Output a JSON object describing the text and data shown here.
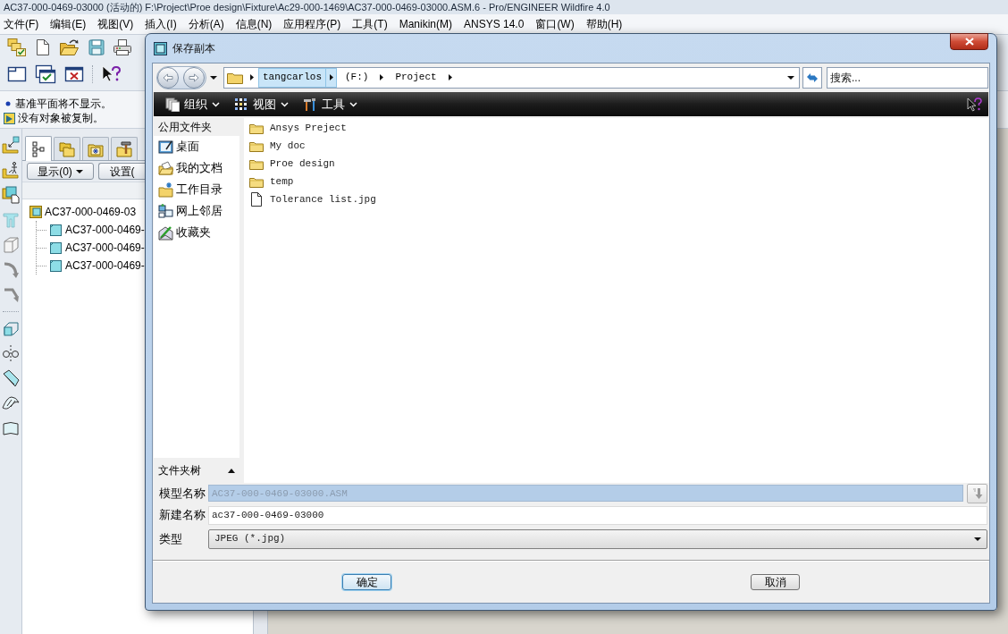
{
  "window": {
    "title": "AC37-000-0469-03000 (活动的) F:\\Project\\Proe design\\Fixture\\Ac29-000-1469\\AC37-000-0469-03000.ASM.6 - Pro/ENGINEER Wildfire 4.0"
  },
  "menu_bar": [
    "文件(F)",
    "编辑(E)",
    "视图(V)",
    "插入(I)",
    "分析(A)",
    "信息(N)",
    "应用程序(P)",
    "工具(T)",
    "Manikin(M)",
    "ANSYS 14.0",
    "窗口(W)",
    "帮助(H)"
  ],
  "messages": [
    {
      "kind": "bullet",
      "text": "基准平面将不显示。"
    },
    {
      "kind": "status",
      "text": "没有对象被复制。"
    }
  ],
  "model_tree": {
    "tabs": [
      {
        "selected": true
      },
      {
        "selected": false
      },
      {
        "selected": false
      },
      {
        "selected": false
      }
    ],
    "buttons": [
      {
        "label": "显示(0)",
        "dropdown": true
      },
      {
        "label": "设置(",
        "dropdown": false
      }
    ],
    "tree": [
      {
        "label": "AC37-000-0469-03",
        "children": [
          {
            "label": "AC37-000-0469-"
          },
          {
            "label": "AC37-000-0469-"
          },
          {
            "label": "AC37-000-0469-"
          }
        ]
      }
    ]
  },
  "dialog": {
    "title": "保存副本",
    "path": [
      {
        "label": "tangcarlos",
        "selected": true
      },
      {
        "label": "(F:)",
        "selected": false
      },
      {
        "label": "Project",
        "selected": false
      }
    ],
    "search": {
      "placeholder": "搜索..."
    },
    "toolbar": [
      "组织",
      "视图",
      "工具"
    ],
    "sidebar": {
      "header": "公用文件夹",
      "items": [
        "桌面",
        "我的文档",
        "工作目录",
        "网上邻居",
        "收藏夹"
      ],
      "footer": "文件夹树"
    },
    "files": [
      {
        "kind": "folder",
        "name": "Ansys Preject"
      },
      {
        "kind": "folder",
        "name": "My doc"
      },
      {
        "kind": "folder",
        "name": "Proe design"
      },
      {
        "kind": "folder",
        "name": "temp"
      },
      {
        "kind": "file",
        "name": "Tolerance list.jpg"
      }
    ],
    "form": [
      {
        "kind": "readonly",
        "label": "模型名称",
        "value": "AC37-000-0469-03000.ASM"
      },
      {
        "kind": "text",
        "label": "新建名称",
        "value": "ac37-000-0469-03000"
      },
      {
        "kind": "select",
        "label": "类型",
        "value": "JPEG (*.jpg)"
      }
    ],
    "buttons": [
      {
        "label": "确定",
        "default": true
      },
      {
        "label": "取消",
        "default": false
      }
    ]
  }
}
